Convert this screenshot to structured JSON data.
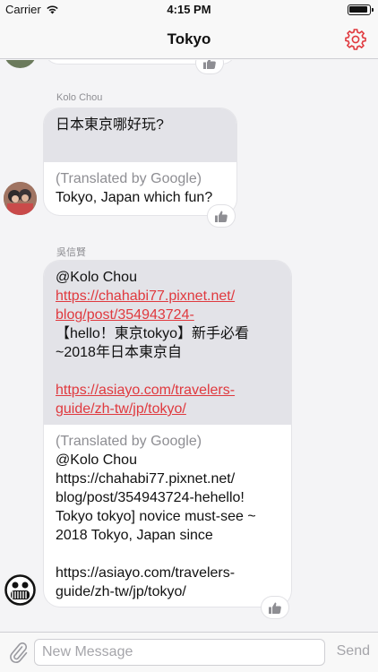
{
  "status": {
    "carrier": "Carrier",
    "time": "4:15 PM"
  },
  "nav": {
    "title": "Tokyo",
    "settings_icon": "gear-icon",
    "accent": "#e0393e"
  },
  "messages": [
    {
      "sender": "Kolo Chou",
      "original": "日本東京哪好玩?",
      "translated_label": "(Translated by Google)",
      "translated": "Tokyo, Japan which fun?"
    },
    {
      "sender": "吳信賢",
      "original_lines": [
        "@Kolo Chou",
        "https://chahabi77.pixnet.net/",
        "blog/post/354943724-",
        "【hello！東京tokyo】新手必看",
        "~2018年日本東京自",
        "https://asiayo.com/travelers-",
        "guide/zh-tw/jp/tokyo/"
      ],
      "translated_label": "(Translated by Google)",
      "translated_lines": [
        "@Kolo Chou",
        "https://chahabi77.pixnet.net/",
        "blog/post/354943724-hehello!",
        "Tokyo tokyo] novice must-see ~",
        "2018 Tokyo, Japan since",
        "https://asiayo.com/travelers-",
        "guide/zh-tw/jp/tokyo/"
      ]
    }
  ],
  "input": {
    "placeholder": "New Message",
    "send_label": "Send"
  }
}
